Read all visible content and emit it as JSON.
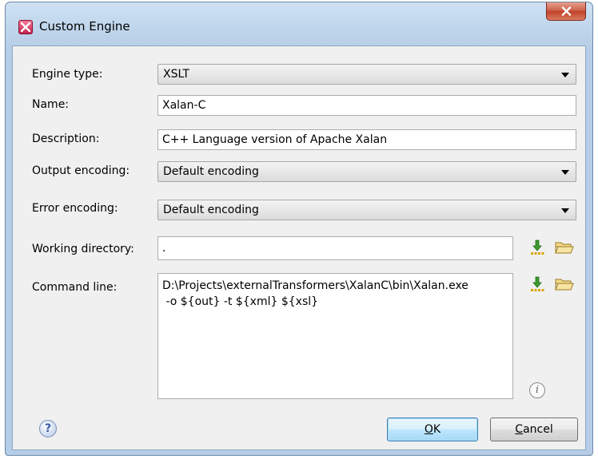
{
  "window": {
    "title": "Custom Engine"
  },
  "form": {
    "engine_type_label": "Engine type:",
    "engine_type_value": "XSLT",
    "name_label": "Name:",
    "name_value": "Xalan-C",
    "description_label": "Description:",
    "description_value": "C++ Language version of Apache Xalan",
    "output_encoding_label": "Output encoding:",
    "output_encoding_value": "Default encoding",
    "error_encoding_label": "Error encoding:",
    "error_encoding_value": "Default encoding",
    "working_directory_label": "Working directory:",
    "working_directory_value": ".",
    "command_line_label": "Command line:",
    "command_line_line1": "D:\\Projects\\externalTransformers\\XalanC\\bin\\Xalan.exe",
    "command_line_line2": " -o ${out} -t ${xml} ${xsl}"
  },
  "buttons": {
    "ok_access_key": "O",
    "ok_rest": "K",
    "cancel_access_key": "C",
    "cancel_rest": "ancel",
    "help_glyph": "?",
    "info_glyph": "i"
  },
  "icons": {
    "insert_editor_variables": "insert-editor-variables-icon",
    "browse_folder": "folder-open-icon"
  }
}
